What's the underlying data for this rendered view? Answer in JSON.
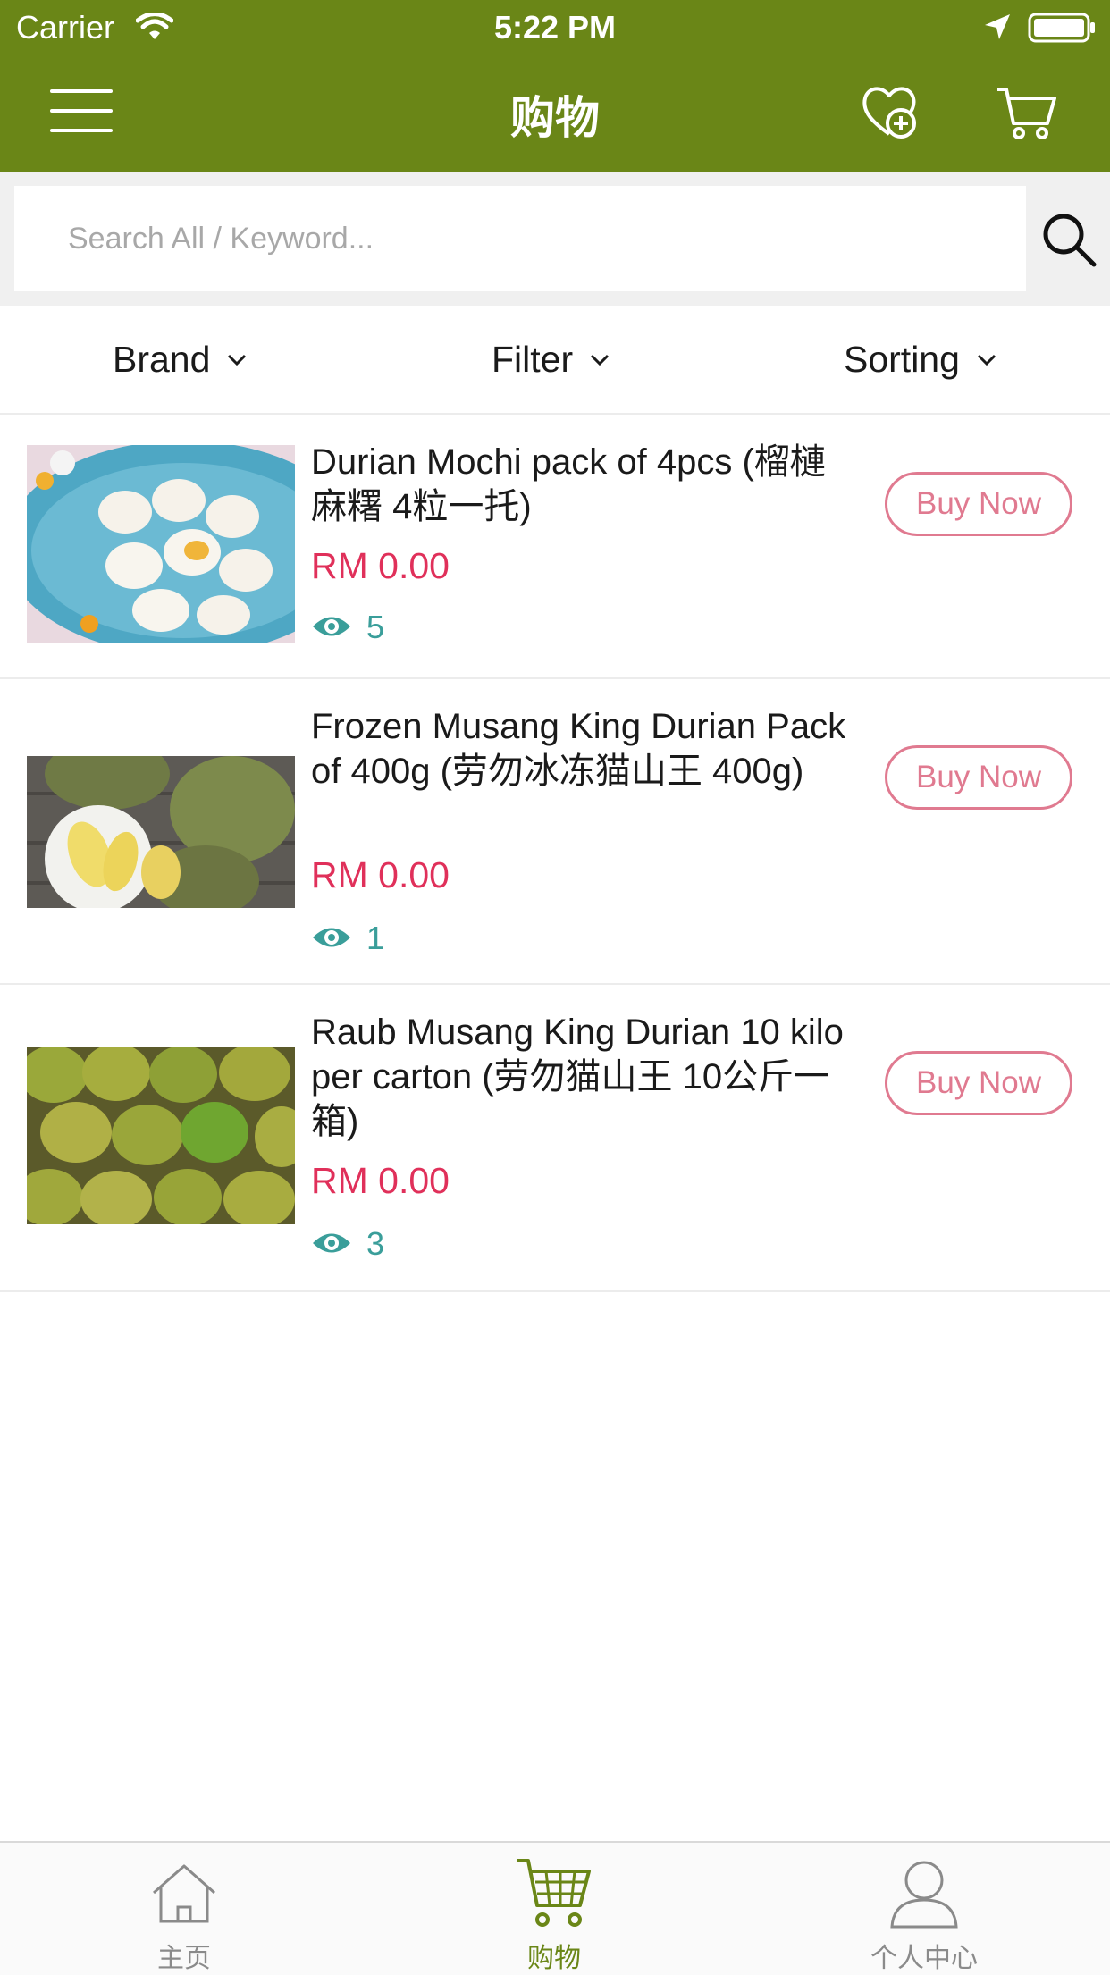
{
  "status_bar": {
    "carrier": "Carrier",
    "time": "5:22 PM"
  },
  "header": {
    "title": "购物"
  },
  "search": {
    "placeholder": "Search All / Keyword..."
  },
  "filters": {
    "brand": "Brand",
    "filter": "Filter",
    "sorting": "Sorting"
  },
  "products": [
    {
      "name": "Durian Mochi pack of 4pcs (榴槤麻糬 4粒一托)",
      "price": "RM 0.00",
      "views": "5",
      "buy_label": "Buy Now"
    },
    {
      "name": "Frozen Musang King Durian Pack of 400g (劳勿冰冻猫山王 400g)",
      "price": "RM 0.00",
      "views": "1",
      "buy_label": "Buy Now"
    },
    {
      "name": "Raub Musang King Durian 10 kilo per carton (劳勿猫山王 10公斤一箱)",
      "price": "RM 0.00",
      "views": "3",
      "buy_label": "Buy Now"
    }
  ],
  "tabbar": {
    "home": "主页",
    "shop": "购物",
    "profile": "个人中心"
  },
  "colors": {
    "header_bg": "#6a8617",
    "price": "#e0305a",
    "views": "#3a9e9a",
    "buy_border": "#e07a90",
    "tab_active": "#6a8617"
  },
  "icons": [
    "wifi-icon",
    "location-arrow-icon",
    "battery-icon",
    "menu-icon",
    "favorite-heart-plus-icon",
    "cart-icon",
    "search-icon",
    "chevron-down-icon",
    "eye-icon",
    "home-icon",
    "shopping-cart-icon",
    "user-icon"
  ]
}
